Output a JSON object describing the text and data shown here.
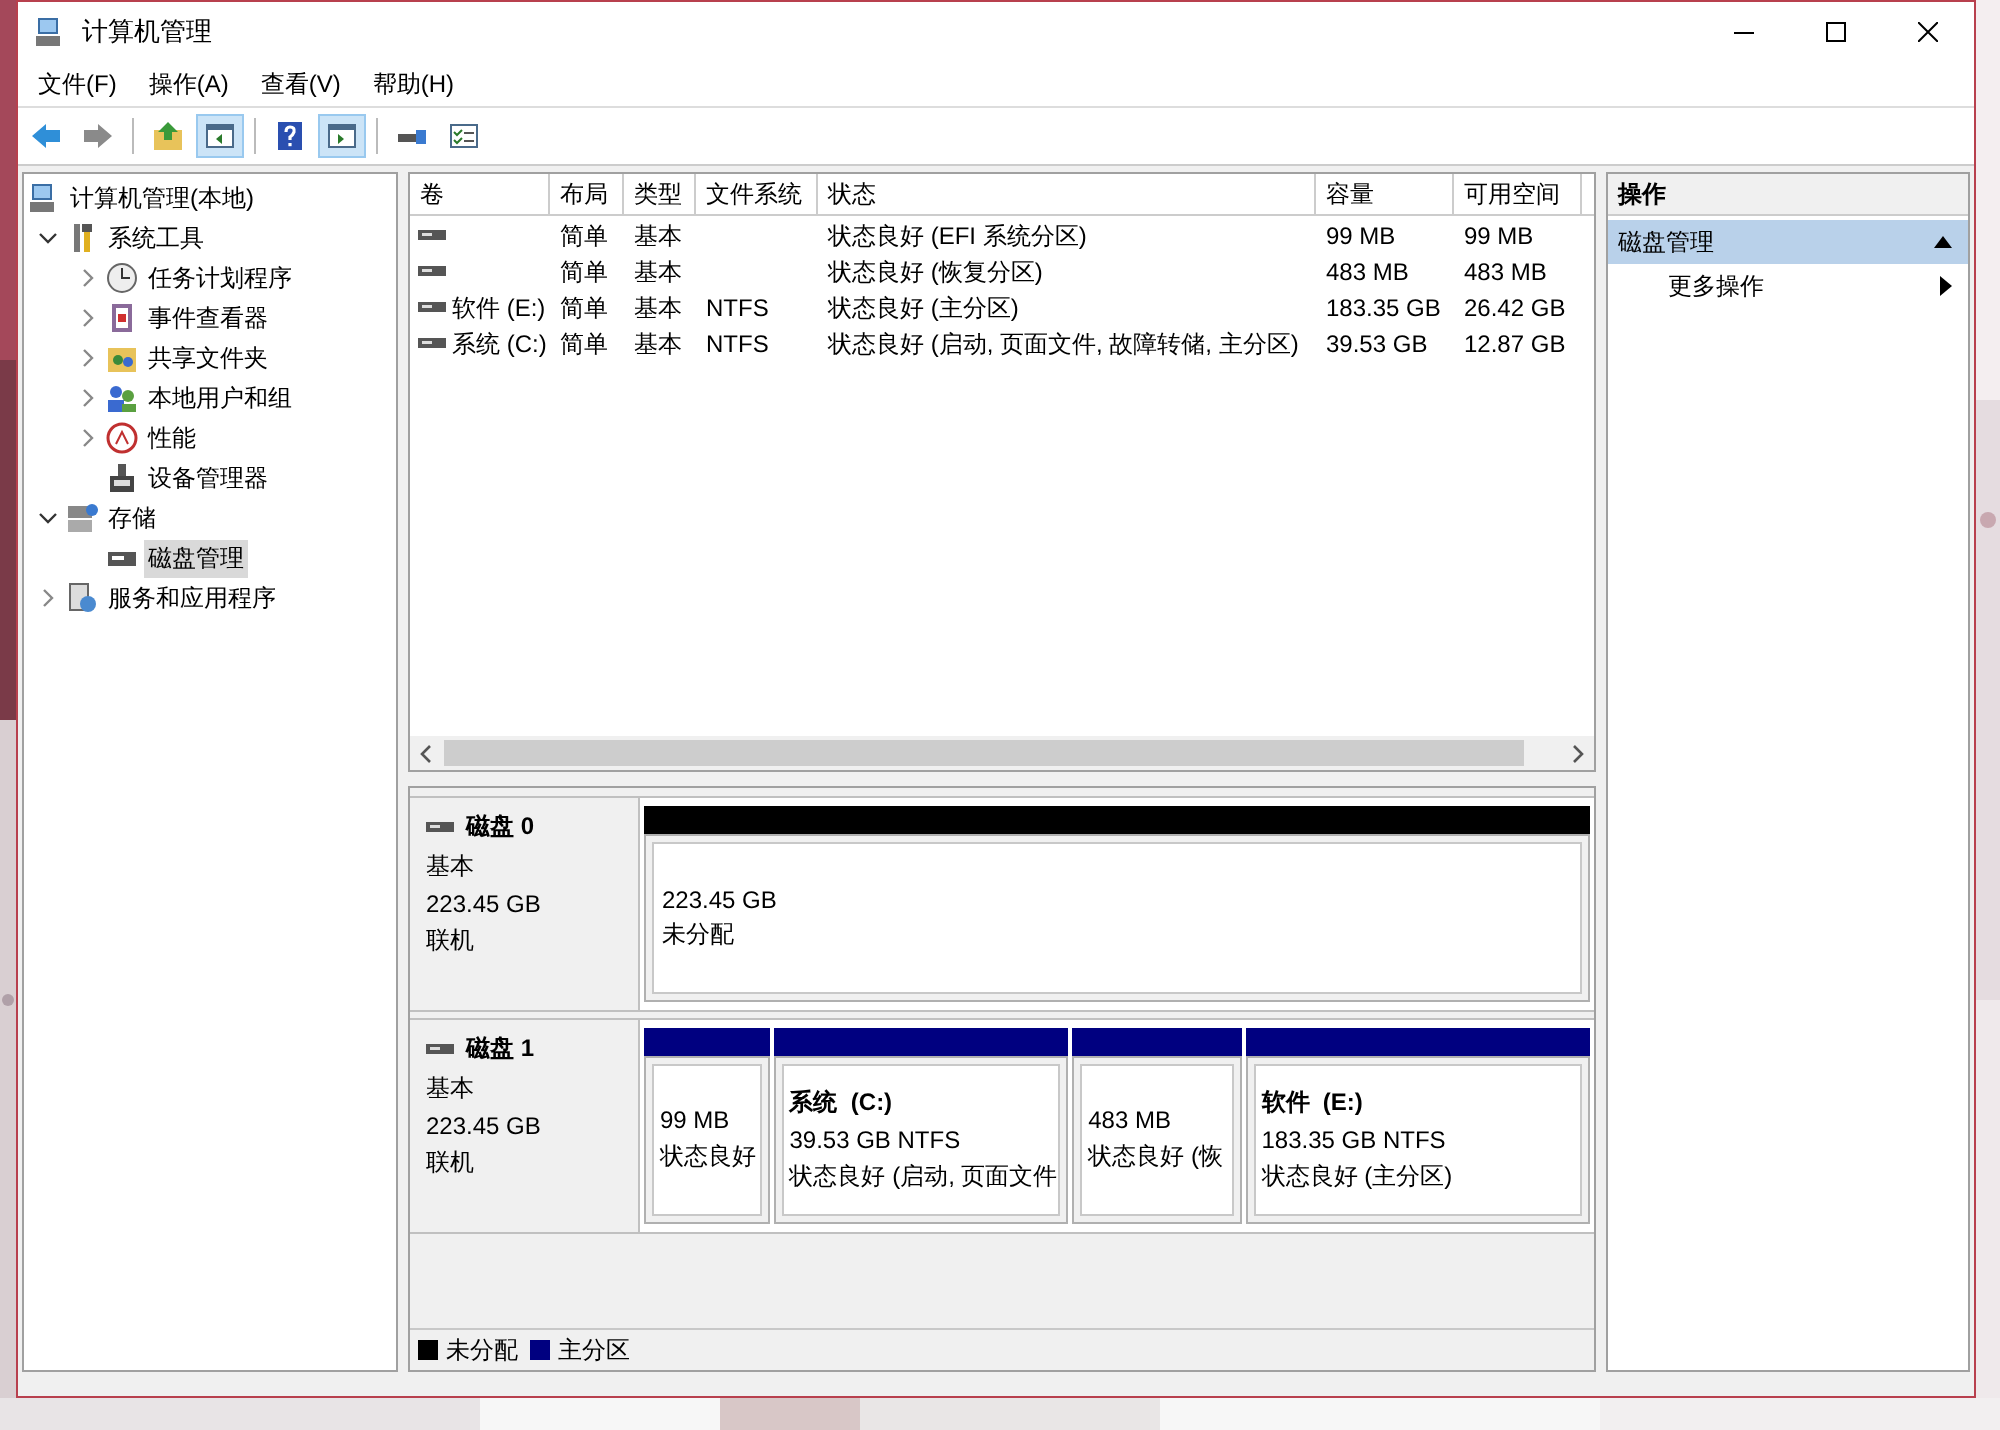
{
  "window": {
    "title": "计算机管理"
  },
  "menu": [
    {
      "label": "文件(F)"
    },
    {
      "label": "操作(A)"
    },
    {
      "label": "查看(V)"
    },
    {
      "label": "帮助(H)"
    }
  ],
  "toolbar": [
    {
      "kind": "back",
      "on": false
    },
    {
      "kind": "forward",
      "on": false
    },
    {
      "kind": "up",
      "on": false
    },
    {
      "kind": "tree",
      "on": true
    },
    {
      "kind": "help",
      "on": false
    },
    {
      "kind": "actions",
      "on": true
    },
    {
      "kind": "connect",
      "on": false
    },
    {
      "kind": "props",
      "on": false
    }
  ],
  "tree": [
    {
      "label": "计算机管理(本地)",
      "selected": false,
      "children": [
        {
          "label": "系统工具",
          "selected": false,
          "expanded": true,
          "children": [
            {
              "label": "任务计划程序",
              "selected": false,
              "expanded": false
            },
            {
              "label": "事件查看器",
              "selected": false,
              "expanded": false
            },
            {
              "label": "共享文件夹",
              "selected": false,
              "expanded": false
            },
            {
              "label": "本地用户和组",
              "selected": false,
              "expanded": false
            },
            {
              "label": "性能",
              "selected": false,
              "expanded": false
            },
            {
              "label": "设备管理器",
              "selected": false
            }
          ]
        },
        {
          "label": "存储",
          "selected": false,
          "expanded": true,
          "children": [
            {
              "label": "磁盘管理",
              "selected": true
            }
          ]
        },
        {
          "label": "服务和应用程序",
          "selected": false,
          "expanded": false
        }
      ]
    }
  ],
  "table": {
    "columns": [
      "卷",
      "布局",
      "类型",
      "文件系统",
      "状态",
      "容量",
      "可用空间"
    ],
    "rows": [
      [
        "",
        "简单",
        "基本",
        "",
        "状态良好 (EFI 系统分区)",
        "99 MB",
        "99 MB"
      ],
      [
        "",
        "简单",
        "基本",
        "",
        "状态良好 (恢复分区)",
        "483 MB",
        "483 MB"
      ],
      [
        "软件 (E:)",
        "简单",
        "基本",
        "NTFS",
        "状态良好 (主分区)",
        "183.35 GB",
        "26.42 GB"
      ],
      [
        "系统 (C:)",
        "简单",
        "基本",
        "NTFS",
        "状态良好 (启动, 页面文件, 故障转储, 主分区)",
        "39.53 GB",
        "12.87 GB"
      ]
    ]
  },
  "disks": [
    {
      "name": "磁盘 0",
      "type": "基本",
      "size": "223.45 GB",
      "status": "联机",
      "partitions": [
        {
          "kind": "unallocated",
          "color": "#000000",
          "size": "223.45 GB",
          "status": "未分配"
        }
      ]
    },
    {
      "name": "磁盘 1",
      "type": "基本",
      "size": "223.45 GB",
      "status": "联机",
      "partitions": [
        {
          "kind": "primary",
          "color": "#000080",
          "size": "99 MB",
          "status": "状态良好"
        },
        {
          "kind": "primary",
          "color": "#000080",
          "name": "系统  (C:)",
          "size": "39.53 GB NTFS",
          "status": "状态良好 (启动, 页面文件"
        },
        {
          "kind": "primary",
          "color": "#000080",
          "size": "483 MB",
          "status": "状态良好 (恢"
        },
        {
          "kind": "primary",
          "color": "#000080",
          "name": "软件  (E:)",
          "size": "183.35 GB NTFS",
          "status": "状态良好 (主分区)"
        }
      ]
    }
  ],
  "legend": [
    {
      "label": "未分配",
      "color": "#000000"
    },
    {
      "label": "主分区",
      "color": "#000080"
    }
  ],
  "actions": {
    "header": "操作",
    "section": {
      "title": "磁盘管理",
      "expanded": true
    },
    "items": [
      {
        "label": "更多操作",
        "submenu": true
      }
    ]
  }
}
